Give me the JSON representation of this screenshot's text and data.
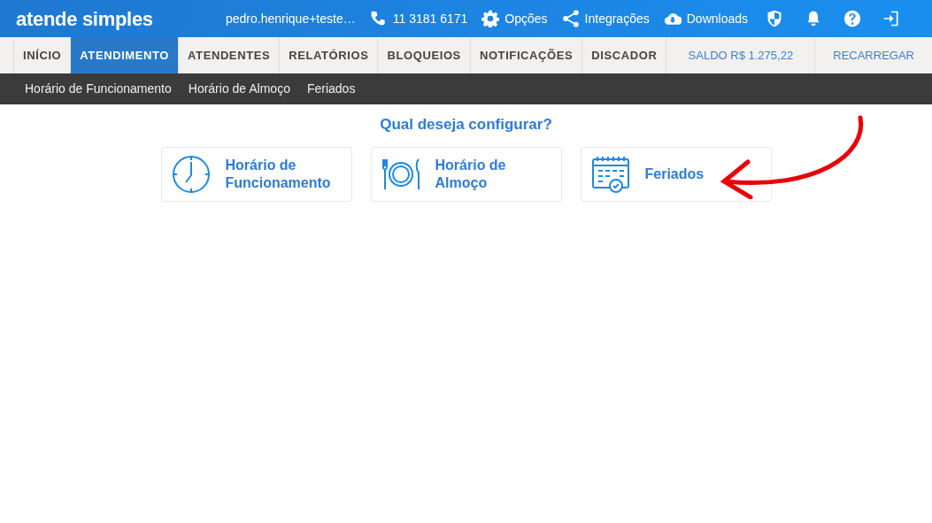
{
  "header": {
    "logo": "atende simples",
    "user": "pedro.henrique+teste…",
    "links": [
      {
        "kind": "phone",
        "label": "11 3181 6171"
      },
      {
        "kind": "gear",
        "label": "Opções"
      },
      {
        "kind": "share",
        "label": "Integrações"
      },
      {
        "kind": "cloud",
        "label": "Downloads"
      },
      {
        "kind": "shield"
      },
      {
        "kind": "bell"
      },
      {
        "kind": "help"
      },
      {
        "kind": "logout"
      }
    ]
  },
  "tabs": [
    {
      "label": "INÍCIO",
      "selected": false
    },
    {
      "label": "ATENDIMENTO",
      "selected": true
    },
    {
      "label": "ATENDENTES",
      "selected": false
    },
    {
      "label": "RELATÓRIOS",
      "selected": false
    },
    {
      "label": "BLOQUEIOS",
      "selected": false
    },
    {
      "label": "NOTIFICAÇÕES",
      "selected": false
    },
    {
      "label": "DISCADOR",
      "selected": false
    }
  ],
  "balance": "SALDO R$ 1.275,22",
  "recharge": "RECARREGAR",
  "subnav": [
    "Horário de Funcionamento",
    "Horário de Almoço",
    "Feriados"
  ],
  "question": "Qual deseja configurar?",
  "options": [
    {
      "kind": "clock",
      "label": "Horário de Funcionamento"
    },
    {
      "kind": "dining",
      "label": "Horário de Almoço"
    },
    {
      "kind": "calendar",
      "label": "Feriados"
    }
  ],
  "annotation": {
    "kind": "arrow"
  }
}
